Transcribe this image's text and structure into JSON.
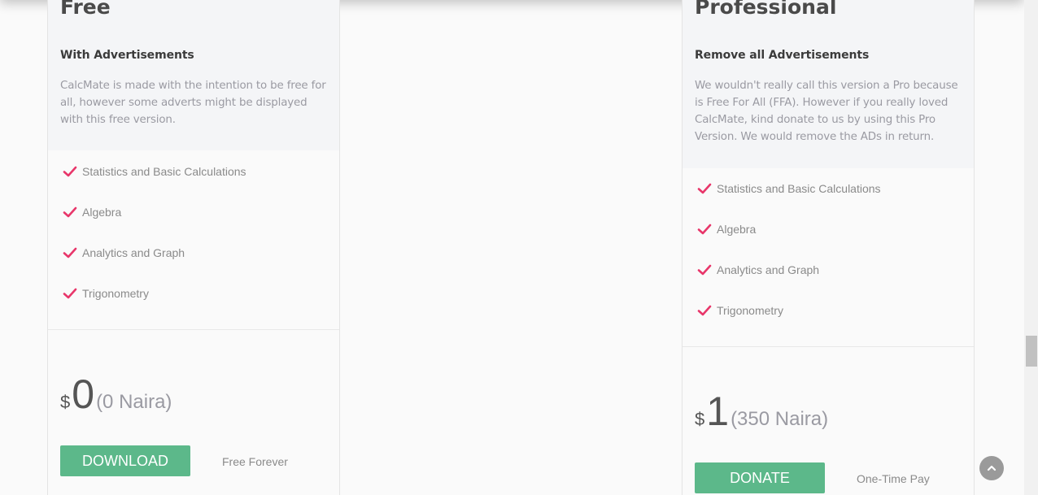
{
  "plans": [
    {
      "title": "Free",
      "subtitle": "With Advertisements",
      "description": "CalcMate is made with the intention to be free for all, however some adverts might be displayed with this free version.",
      "features": [
        "Statistics and Basic Calculations",
        "Algebra",
        "Analytics and Graph",
        "Trigonometry"
      ],
      "currency": "$",
      "amount": "0",
      "amount_note": "(0 Naira)",
      "button_label": "DOWNLOAD",
      "button_note": "Free Forever"
    },
    {
      "title": "Professional",
      "subtitle": "Remove all Advertisements",
      "description": "We wouldn't really call this version a Pro because is Free For All (FFA). However if you really loved CalcMate, kind donate to us by using this Pro Version. We would remove the ADs in return.",
      "features": [
        "Statistics and Basic Calculations",
        "Algebra",
        "Analytics and Graph",
        "Trigonometry"
      ],
      "currency": "$",
      "amount": "1",
      "amount_note": "(350 Naira)",
      "button_label": "DONATE",
      "button_note": "One-Time Pay"
    }
  ],
  "icons": {
    "feature_check": "check-icon",
    "back_to_top": "chevron-up-icon"
  },
  "colors": {
    "accent_check": "#e8366a",
    "button": "#5cb88a"
  }
}
